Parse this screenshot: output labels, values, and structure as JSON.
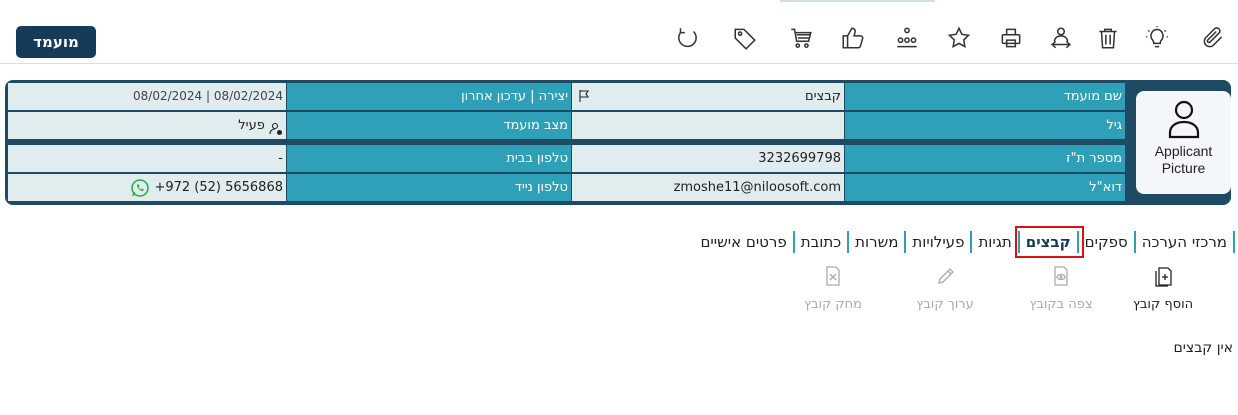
{
  "toolbar": {
    "candidate_button": "מועמד",
    "icons": [
      "paperclip-icon",
      "lightbulb-icon",
      "trash-icon",
      "person-transfer-icon",
      "print-icon",
      "star-icon",
      "hierarchy-icon",
      "thumbs-up-icon",
      "cart-icon",
      "tag-icon",
      "refresh-icon"
    ]
  },
  "applicant": {
    "picture_label": "Applicant Picture",
    "fields": {
      "name_label": "שם מועמד",
      "name_value": "קבצים",
      "created_label": "יצירה | עדכון אחרון",
      "created_value": "08/02/2024 | 08/02/2024",
      "age_label": "גיל",
      "age_value": "",
      "status_label": "מצב מועמד",
      "status_value": "פעיל",
      "id_label": "מספר ת\"ז",
      "id_value": "3232699798",
      "home_phone_label": "טלפון בבית",
      "home_phone_value": "-",
      "email_label": "דוא\"ל",
      "email_value": "zmoshe11@niloosoft.com",
      "mobile_label": "טלפון נייד",
      "mobile_value": "+972 (52) 5656868"
    }
  },
  "tabs": [
    {
      "label": "פרטים אישיים",
      "active": false
    },
    {
      "label": "כתובת",
      "active": false
    },
    {
      "label": "משרות",
      "active": false
    },
    {
      "label": "פעילויות",
      "active": false
    },
    {
      "label": "תגיות",
      "active": false
    },
    {
      "label": "קבצים",
      "active": true
    },
    {
      "label": "ספקים",
      "active": false
    },
    {
      "label": "מרכזי הערכה",
      "active": false
    }
  ],
  "file_actions": {
    "add": "הוסף קובץ",
    "view": "צפה בקובץ",
    "edit": "ערוך קובץ",
    "delete": "מחק קובץ"
  },
  "empty_message": "אין קבצים",
  "colors": {
    "navy": "#163a5a",
    "teal": "#2ea1b8",
    "value_bg": "#e1ecef",
    "panel_bg": "#1e4a63",
    "active_tab_outline": "#e01010"
  }
}
